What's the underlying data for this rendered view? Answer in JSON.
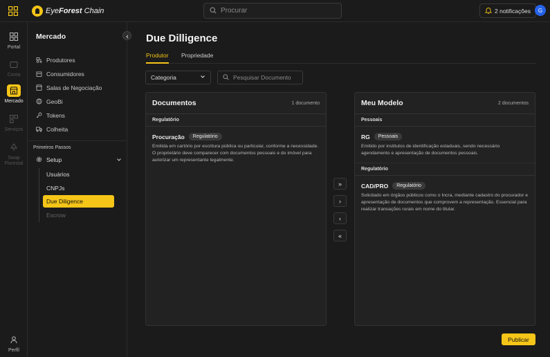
{
  "app": {
    "brand_prefix": "Eye",
    "brand_bold": "Forest",
    "brand_suffix": " Chain"
  },
  "topbar": {
    "search_placeholder": "Procurar",
    "notifications_label": "2 notificações",
    "avatar_initial": "G"
  },
  "rail": {
    "items": [
      {
        "label": "Portal",
        "icon": "grid-icon"
      },
      {
        "label": "Conta",
        "icon": "wallet-icon"
      },
      {
        "label": "Mercado",
        "icon": "store-icon"
      },
      {
        "label": "Serviços",
        "icon": "services-icon"
      },
      {
        "label": "Swap Florestal",
        "icon": "tree-icon"
      },
      {
        "label": "Perfil",
        "icon": "user-icon"
      }
    ]
  },
  "sidebar": {
    "title": "Mercado",
    "items": [
      {
        "label": "Produtores",
        "icon": "tractor-icon"
      },
      {
        "label": "Consumidores",
        "icon": "building-icon"
      },
      {
        "label": "Salas de Negociação",
        "icon": "store-icon"
      },
      {
        "label": "GeoBi",
        "icon": "globe-icon"
      },
      {
        "label": "Tokens",
        "icon": "key-icon"
      },
      {
        "label": "Colheita",
        "icon": "truck-icon"
      }
    ],
    "group_label": "Primeiros Passos",
    "setup_label": "Setup",
    "sub_items": [
      {
        "label": "Usuários"
      },
      {
        "label": "CNPJs"
      },
      {
        "label": "Due Diligence"
      },
      {
        "label": "Escrow"
      }
    ]
  },
  "main": {
    "title": "Due Dilligence",
    "tabs": [
      {
        "label": "Produtor"
      },
      {
        "label": "Propriedade"
      }
    ],
    "category_label": "Categoria",
    "doc_search_placeholder": "Pesquisar Documento",
    "publish_label": "Publicar"
  },
  "documentos": {
    "title": "Documentos",
    "count": "1 documento",
    "sections": [
      {
        "label": "Regulatório",
        "docs": [
          {
            "name": "Procuração",
            "badge": "Regulatório",
            "desc": "Emitida em cartório por escritura pública ou particular, conforme a necessidade. O proprietário deve comparecer com documentos pessoais e do imóvel para autorizar um representante legalmente."
          }
        ]
      }
    ]
  },
  "modelo": {
    "title": "Meu Modelo",
    "count": "2 documentos",
    "sections": [
      {
        "label": "Pessoais",
        "docs": [
          {
            "name": "RG",
            "badge": "Pessoais",
            "desc": "Emitido por institutos de identificação estaduais, sendo necessário agendamento e apresentação de documentos pessoais."
          }
        ]
      },
      {
        "label": "Regulatório",
        "docs": [
          {
            "name": "CAD/PRO",
            "badge": "Regulatório",
            "desc": "Solicitado em órgãos públicos como o Incra, mediante cadastro do procurador e apresentação de documentos que comprovem a representação. Essencial para realizar transações rurais em nome do titular."
          }
        ]
      }
    ]
  },
  "movers": [
    "»",
    "›",
    "‹",
    "«"
  ],
  "colors": {
    "accent": "#f5c518",
    "background": "#1b1b1b",
    "panel": "#222222",
    "avatar": "#2563eb"
  }
}
